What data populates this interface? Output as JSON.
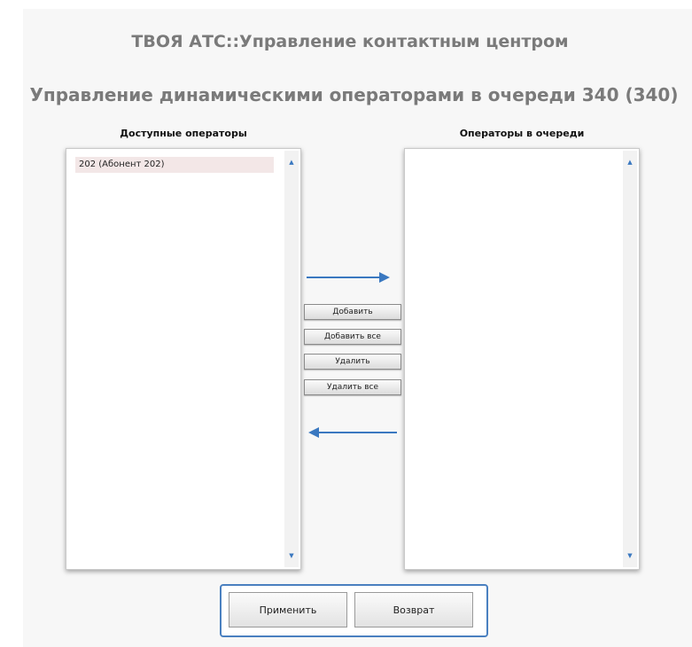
{
  "header": {
    "app_title": "ТВОЯ АТС::Управление контактным центром",
    "page_title": "Управление динамическими операторами в очереди 340 (340)"
  },
  "available_list": {
    "label": "Доступные операторы",
    "items": [
      "202 (Абонент 202)"
    ]
  },
  "queue_list": {
    "label": "Операторы в очереди",
    "items": []
  },
  "move_buttons": {
    "add": "Добавить",
    "add_all": "Добавить все",
    "remove": "Удалить",
    "remove_all": "Удалить все"
  },
  "actions": {
    "apply": "Применить",
    "back": "Возврат"
  },
  "icons": {
    "move_right": "arrow-right-icon",
    "move_left": "arrow-left-icon",
    "scroll_up": "scroll-up-icon",
    "scroll_down": "scroll-down-icon"
  },
  "colors": {
    "title_text": "#7a7a7a",
    "accent": "#3a78c0",
    "selected_item": "#f3e7e7"
  }
}
